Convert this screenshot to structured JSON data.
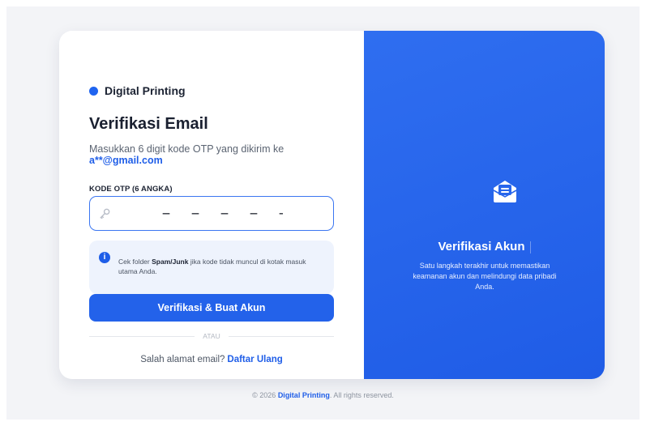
{
  "brand": {
    "name": "Digital Printing"
  },
  "verify": {
    "title": "Verifikasi Email",
    "subtitle": "Masukkan 6 digit kode OTP yang dikirim ke",
    "email": "a**@gmail.com",
    "otp_label": "KODE OTP (6 ANGKA)",
    "otp_value": "",
    "otp_placeholder": "– – – – – –",
    "info": {
      "prefix": "Cek folder ",
      "emphasis": "Spam/Junk",
      "suffix": " jika kode tidak muncul di kotak masuk utama Anda."
    },
    "submit_label": "Verifikasi & Buat Akun",
    "divider_text": "ATAU",
    "reregister_prompt": "Salah alamat email?",
    "reregister_link": "Daftar Ulang"
  },
  "panel": {
    "icon": "envelope-icon",
    "title": "Verifikasi Akun",
    "description": "Satu langkah terakhir untuk memastikan keamanan akun dan melindungi data pribadi Anda."
  },
  "footer": {
    "prefix": "© 2026 ",
    "brand": "Digital Printing",
    "suffix": ". All rights reserved."
  },
  "colors": {
    "accent": "#2362ea",
    "panel_bg": "#2866ec",
    "info_bg": "#eef3fd"
  }
}
